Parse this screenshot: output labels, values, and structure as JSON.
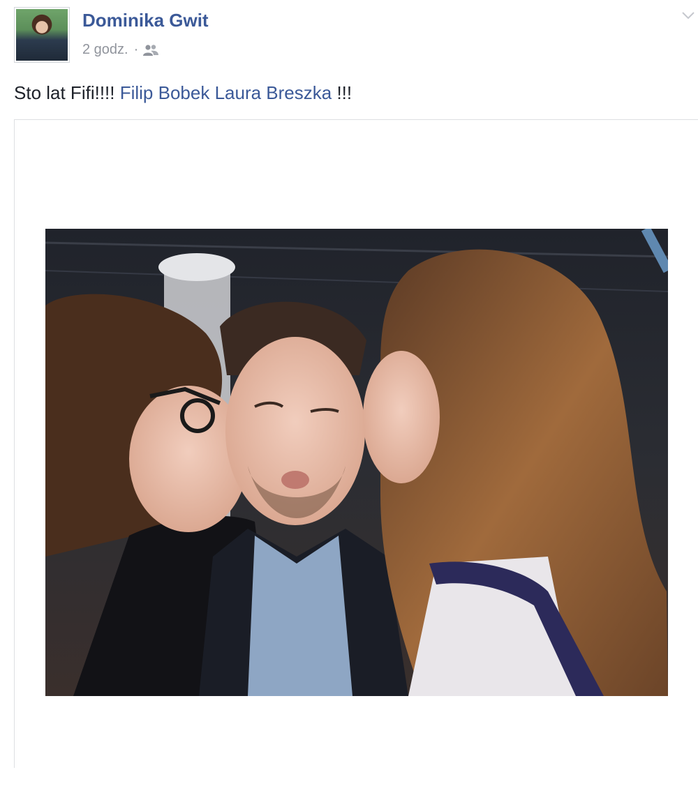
{
  "post": {
    "author_name": "Dominika Gwit",
    "timestamp": "2 godz.",
    "separator": "·",
    "audience_icon": "friends-icon",
    "menu_icon": "chevron-down-icon",
    "text": {
      "prefix": "Sto lat Fifi!!!! ",
      "tag_1": "Filip Bobek",
      "space": " ",
      "tag_2": "Laura Breszka",
      "suffix": " !!!"
    },
    "photo_icon": "photo-three-people-kissing-cheeks"
  },
  "colors": {
    "link": "#3b5998",
    "text": "#1d2129",
    "meta": "#90949c",
    "border": "#dddfe2"
  }
}
